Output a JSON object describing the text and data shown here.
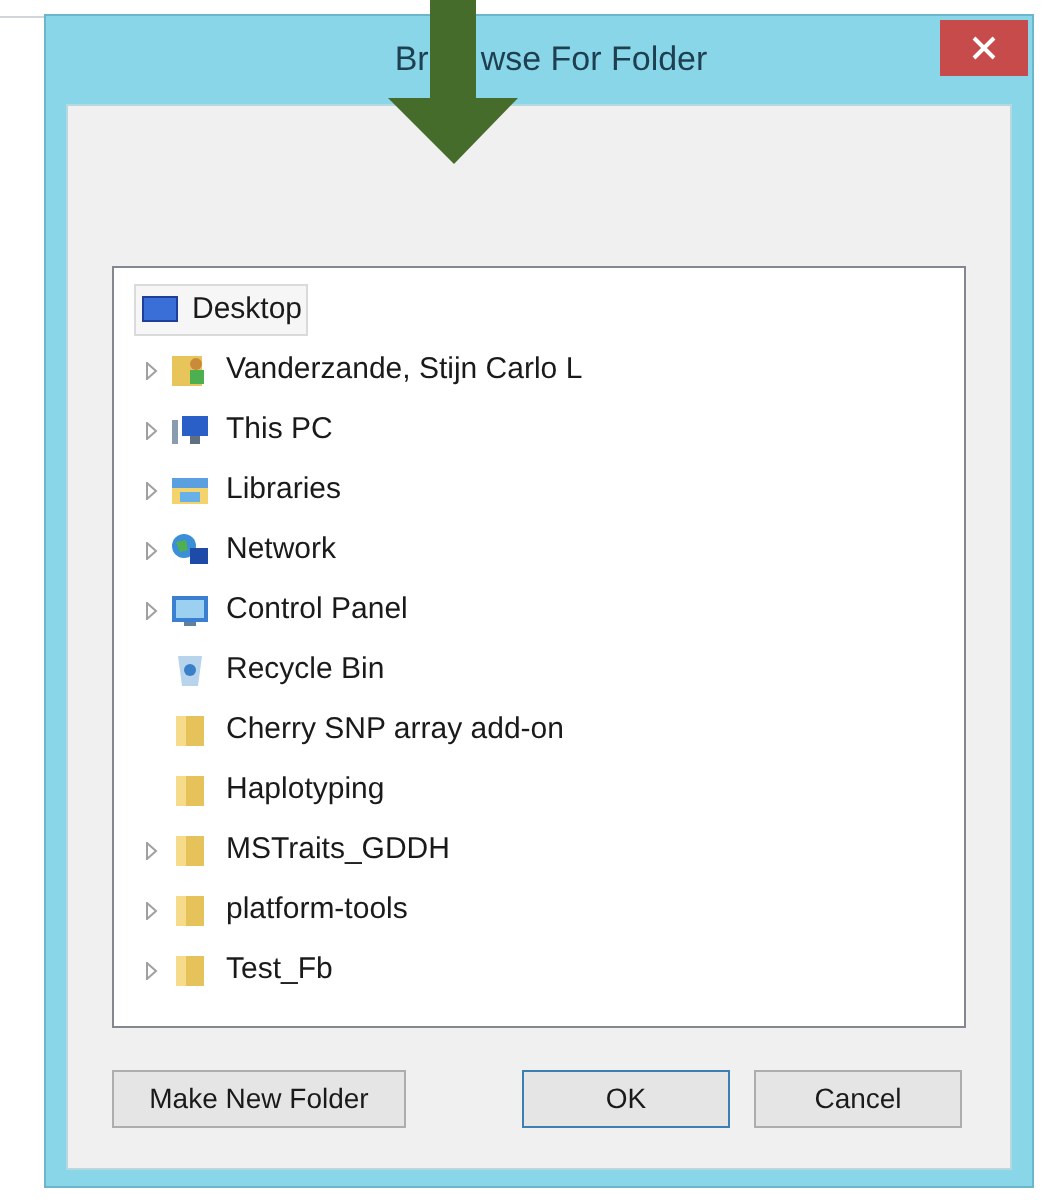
{
  "window": {
    "title_before_arrow": "Br",
    "title_after_arrow": "wse For Folder"
  },
  "tree": {
    "root": {
      "label": "Desktop",
      "kind": "desktop",
      "selected": true
    },
    "children": [
      {
        "label": "Vanderzande, Stijn Carlo L",
        "kind": "user",
        "expandable": true
      },
      {
        "label": "This PC",
        "kind": "pc",
        "expandable": true
      },
      {
        "label": "Libraries",
        "kind": "libraries",
        "expandable": true
      },
      {
        "label": "Network",
        "kind": "network",
        "expandable": true
      },
      {
        "label": "Control Panel",
        "kind": "control-panel",
        "expandable": true
      },
      {
        "label": "Recycle Bin",
        "kind": "recycle-bin",
        "expandable": false
      },
      {
        "label": "Cherry SNP array add-on",
        "kind": "folder",
        "expandable": false
      },
      {
        "label": "Haplotyping",
        "kind": "folder",
        "expandable": false
      },
      {
        "label": "MSTraits_GDDH",
        "kind": "folder",
        "expandable": true
      },
      {
        "label": "platform-tools",
        "kind": "folder",
        "expandable": true
      },
      {
        "label": "Test_Fb",
        "kind": "folder",
        "expandable": true
      }
    ]
  },
  "buttons": [
    {
      "label": "Make New Folder",
      "kind": "normal"
    },
    {
      "label": "OK",
      "kind": "default"
    },
    {
      "label": "Cancel",
      "kind": "normal"
    }
  ]
}
